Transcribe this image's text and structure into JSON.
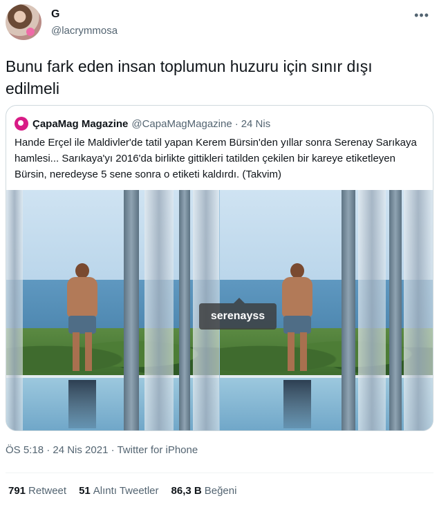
{
  "author": {
    "name": "G",
    "handle": "@lacrymmosa",
    "more": "•••"
  },
  "tweet": {
    "text": "Bunu fark eden insan toplumun huzuru için sınır dışı edilmeli"
  },
  "quoted": {
    "name": "ÇapaMag Magazine",
    "handle": "@CapaMagMagazine",
    "dot": "·",
    "date": "24 Nis",
    "text": "Hande Erçel ile Maldivler'de tatil yapan Kerem Bürsin'den yıllar sonra Serenay Sarıkaya hamlesi... Sarıkaya'yı 2016'da birlikte gittikleri tatilden çekilen bir kareye etiketleyen Bürsin, neredeyse 5 sene sonra o etiketi kaldırdı. (Takvim)",
    "image_tag": "serenayss"
  },
  "meta": {
    "text": "ÖS 5:18 · 24 Nis 2021 · Twitter for iPhone"
  },
  "stats": [
    {
      "value": "791",
      "label": "Retweet"
    },
    {
      "value": "51",
      "label": "Alıntı Tweetler"
    },
    {
      "value": "86,3 B",
      "label": "Beğeni"
    }
  ],
  "colors": {
    "text": "#0f1419",
    "secondary": "#536471",
    "border": "#cfd9de",
    "quote_avatar": "#d81b86"
  }
}
